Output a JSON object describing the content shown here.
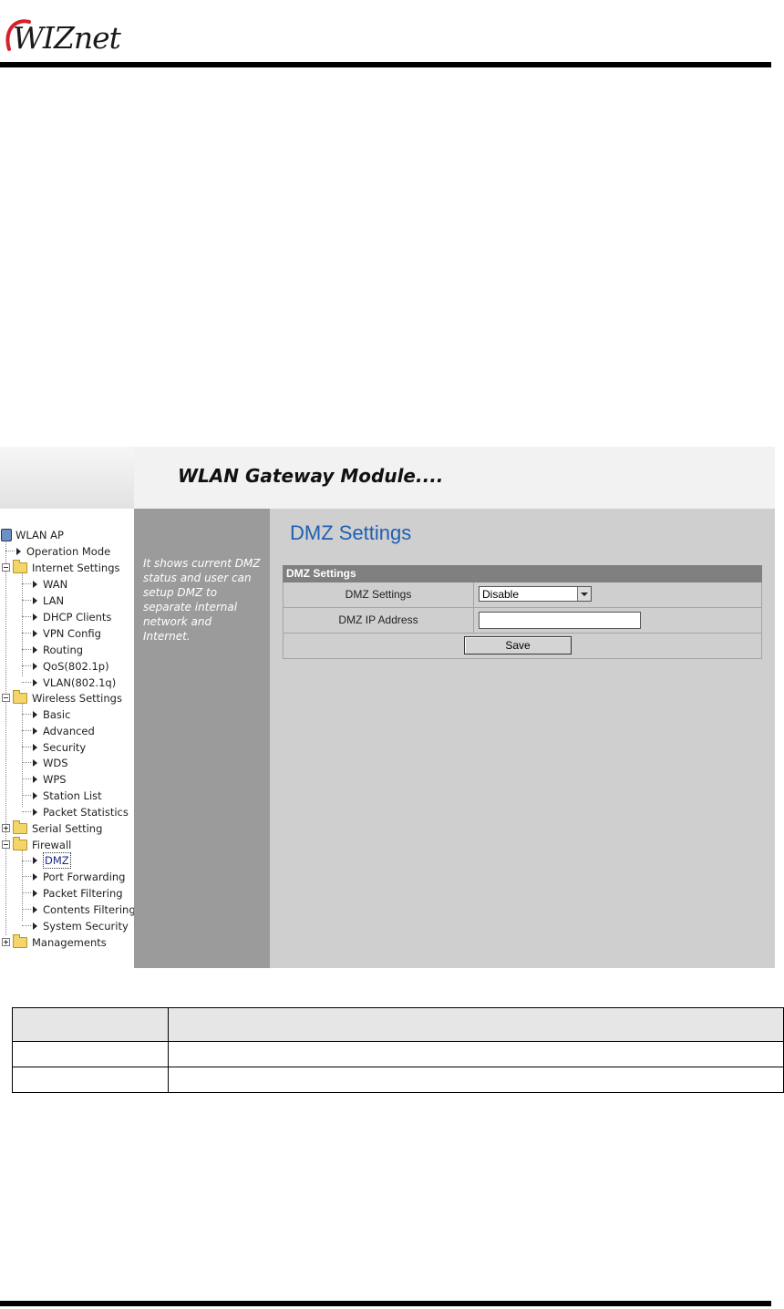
{
  "logo": {
    "text": "WIZnet"
  },
  "banner": {
    "title": "WLAN Gateway Module...."
  },
  "tree": {
    "root": "WLAN AP",
    "operation_mode": "Operation Mode",
    "internet": {
      "label": "Internet Settings",
      "items": [
        "WAN",
        "LAN",
        "DHCP Clients",
        "VPN Config",
        "Routing",
        "QoS(802.1p)",
        "VLAN(802.1q)"
      ]
    },
    "wireless": {
      "label": "Wireless Settings",
      "items": [
        "Basic",
        "Advanced",
        "Security",
        "WDS",
        "WPS",
        "Station List",
        "Packet Statistics"
      ]
    },
    "serial": {
      "label": "Serial Setting"
    },
    "firewall": {
      "label": "Firewall",
      "items": [
        "DMZ",
        "Port Forwarding",
        "Packet Filtering",
        "Contents Filtering",
        "System Security"
      ]
    },
    "managements": {
      "label": "Managements"
    }
  },
  "help": {
    "text": "It shows current DMZ status and user can setup DMZ to separate internal network and Internet."
  },
  "main": {
    "title": "DMZ Settings",
    "panel_header": "DMZ Settings",
    "rows": {
      "dmz_settings_label": "DMZ Settings",
      "dmz_settings_value": "Disable",
      "dmz_ip_label": "DMZ IP Address",
      "dmz_ip_value": ""
    },
    "save_label": "Save"
  },
  "colors": {
    "title_blue": "#1f5fb4",
    "help_bg": "#9b9b9b",
    "main_bg": "#cfcfcf",
    "panel_head": "#808080"
  }
}
